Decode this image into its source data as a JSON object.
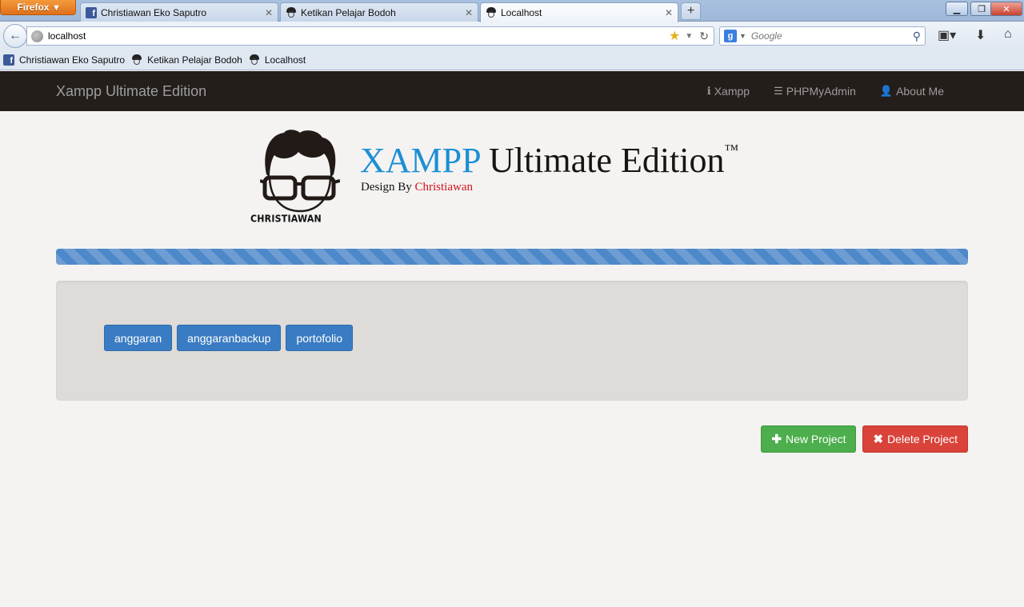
{
  "browser": {
    "menu_button": "Firefox",
    "tabs": [
      {
        "label": "Christiawan Eko Saputro",
        "icon": "facebook-icon"
      },
      {
        "label": "Ketikan Pelajar Bodoh",
        "icon": "face-icon"
      },
      {
        "label": "Localhost",
        "icon": "face-icon",
        "active": true
      }
    ],
    "url": "localhost",
    "search_placeholder": "Google",
    "bookmarks": [
      {
        "label": "Christiawan Eko Saputro",
        "icon": "facebook-icon"
      },
      {
        "label": "Ketikan Pelajar Bodoh",
        "icon": "face-icon"
      },
      {
        "label": "Localhost",
        "icon": "face-icon"
      }
    ]
  },
  "navbar": {
    "brand": "Xampp Ultimate Edition",
    "items": [
      {
        "label": "Xampp",
        "icon": "info-icon"
      },
      {
        "label": "PHPMyAdmin",
        "icon": "list-icon"
      },
      {
        "label": "About Me",
        "icon": "user-icon"
      }
    ]
  },
  "hero": {
    "logo_name": "CHRISTIAWAN",
    "title_highlight": "XAMPP",
    "title_rest": "Ultimate Edition",
    "trademark": "™",
    "subtitle_prefix": "Design By",
    "subtitle_author": "Christiawan"
  },
  "progress": {
    "value_percent": 100,
    "color": "#4d88c9"
  },
  "projects": [
    "anggaran",
    "anggaranbackup",
    "portofolio"
  ],
  "actions": {
    "new_project": "New Project",
    "delete_project": "Delete Project"
  },
  "colors": {
    "navbar_bg": "#241e1b",
    "primary": "#3a7cc3",
    "success": "#4cae4c",
    "danger": "#d9433a",
    "xampp_blue": "#1c8fd3",
    "author_red": "#d2141e"
  }
}
